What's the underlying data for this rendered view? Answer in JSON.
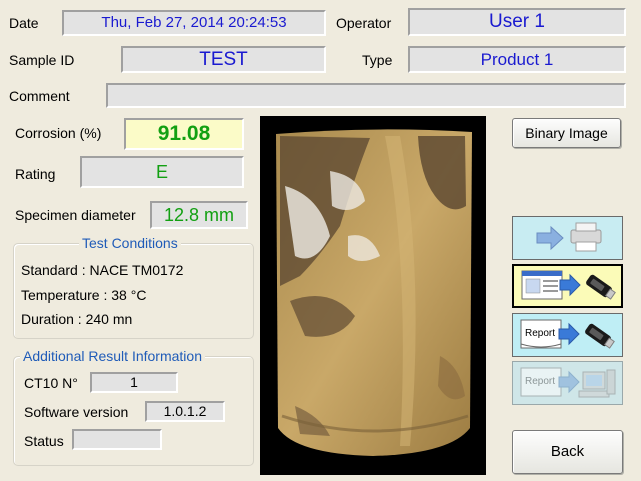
{
  "header": {
    "date_label": "Date",
    "date_value": "Thu, Feb 27, 2014  20:24:53",
    "operator_label": "Operator",
    "operator_value": "User 1",
    "sample_id_label": "Sample ID",
    "sample_id_value": "TEST",
    "type_label": "Type",
    "type_value": "Product 1",
    "comment_label": "Comment",
    "comment_value": ""
  },
  "results": {
    "corrosion_label": "Corrosion (%)",
    "corrosion_value": "91.08",
    "rating_label": "Rating",
    "rating_value": "E",
    "diameter_label": "Specimen diameter",
    "diameter_value": "12.8 mm"
  },
  "test_conditions": {
    "title": "Test Conditions",
    "standard": "Standard : NACE TM0172",
    "temperature": "Temperature : 38 °C",
    "duration": "Duration : 240 mn"
  },
  "additional": {
    "title": "Additional Result Information",
    "ct10_label": "CT10 N°",
    "ct10_value": "1",
    "software_label": "Software version",
    "software_value": "1.0.1.2",
    "status_label": "Status",
    "status_value": ""
  },
  "buttons": {
    "binary_image": "Binary Image",
    "back": "Back",
    "report_icon_text": "Report",
    "report_icon_text_disabled": "Report"
  },
  "colors": {
    "background": "#efebde",
    "field_text": "#1a1ad0",
    "result_text": "#12a012",
    "corrosion_field_bg": "#fbfbc8",
    "group_title": "#1f5bb8",
    "print_button_bg": "#c8ecf2",
    "export_image_bg": "#fbfbb8",
    "report_button_bg": "#bfeef5",
    "report_disabled_bg": "#cfe6e8"
  },
  "icons": {
    "print": "arrow-to-printer-icon",
    "export_image": "image-to-usb-icon",
    "export_report": "report-to-usb-icon",
    "report_pc": "report-to-computer-icon"
  }
}
